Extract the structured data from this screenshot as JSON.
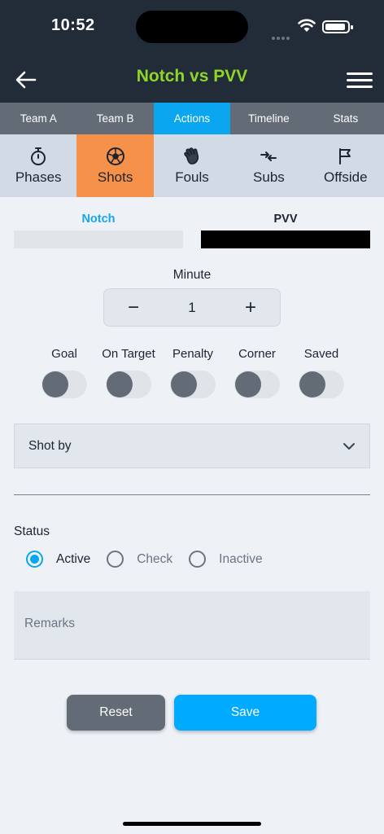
{
  "status_bar": {
    "time": "10:52"
  },
  "header": {
    "title": "Notch vs PVV"
  },
  "tabs": [
    {
      "label": "Team A",
      "active": false
    },
    {
      "label": "Team B",
      "active": false
    },
    {
      "label": "Actions",
      "active": true
    },
    {
      "label": "Timeline",
      "active": false
    },
    {
      "label": "Stats",
      "active": false
    }
  ],
  "subtabs": [
    {
      "label": "Phases",
      "icon": "stopwatch-icon",
      "active": false
    },
    {
      "label": "Shots",
      "icon": "soccer-ball-icon",
      "active": true
    },
    {
      "label": "Fouls",
      "icon": "hand-icon",
      "active": false
    },
    {
      "label": "Subs",
      "icon": "swap-arrows-icon",
      "active": false
    },
    {
      "label": "Offside",
      "icon": "flag-icon",
      "active": false
    }
  ],
  "teams": {
    "a": "Notch",
    "b": "PVV"
  },
  "minute": {
    "label": "Minute",
    "value": "1",
    "minus": "−",
    "plus": "+"
  },
  "toggles": [
    {
      "label": "Goal",
      "on": false
    },
    {
      "label": "On Target",
      "on": false
    },
    {
      "label": "Penalty",
      "on": false
    },
    {
      "label": "Corner",
      "on": false
    },
    {
      "label": "Saved",
      "on": false
    }
  ],
  "shot_by": {
    "placeholder": "Shot by"
  },
  "status": {
    "label": "Status",
    "options": [
      {
        "label": "Active",
        "checked": true
      },
      {
        "label": "Check",
        "checked": false
      },
      {
        "label": "Inactive",
        "checked": false
      }
    ]
  },
  "remarks": {
    "placeholder": "Remarks"
  },
  "buttons": {
    "reset": "Reset",
    "save": "Save"
  },
  "colors": {
    "header_bg": "#222b38",
    "title": "#8fd629",
    "active_tab": "#0aa6f0",
    "active_subtab": "#f6914a",
    "save": "#00aaff",
    "reset": "#636b76"
  }
}
